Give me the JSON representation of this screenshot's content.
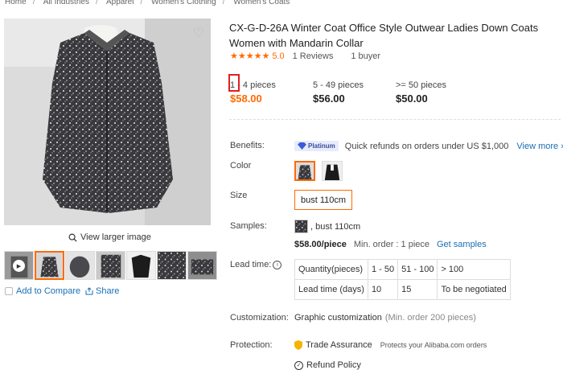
{
  "breadcrumb": [
    "Home",
    "All Industries",
    "Apparel",
    "Women's Clothing",
    "Women's Coats"
  ],
  "gallery": {
    "view_larger": "View larger image",
    "thumb_count": 7,
    "add_to_compare": "Add to Compare",
    "share": "Share"
  },
  "product": {
    "title": "CX-G-D-26A Winter Coat Office Style Outwear Ladies Down Coats Women with Mandarin Collar",
    "rating_stars": "★★★★★",
    "rating_score": "5.0",
    "reviews": "1 Reviews",
    "buyers": "1 buyer"
  },
  "price_tiers": [
    {
      "qty_num": "1",
      "qty_rest": " - 4 pieces",
      "price": "$58.00"
    },
    {
      "qty": "5 - 49 pieces",
      "price": "$56.00"
    },
    {
      "qty": ">= 50 pieces",
      "price": "$50.00"
    }
  ],
  "labels": {
    "benefits": "Benefits:",
    "color": "Color",
    "size": "Size",
    "samples": "Samples:",
    "lead_time": "Lead time:",
    "customization": "Customization:",
    "protection": "Protection:"
  },
  "benefits": {
    "badge": "Platinum",
    "text": "Quick refunds on orders under US $1,000",
    "view_more": "View more"
  },
  "size": {
    "selected": "bust 110cm"
  },
  "samples": {
    "variant": ", bust 110cm",
    "price": "$58.00/piece",
    "min_order": "Min. order : 1 piece",
    "get_samples": "Get samples"
  },
  "lead_time_table": {
    "rows": [
      [
        "Quantity(pieces)",
        "1 - 50",
        "51 - 100",
        "> 100"
      ],
      [
        "Lead time (days)",
        "10",
        "15",
        "To be negotiated"
      ]
    ]
  },
  "customization": {
    "value": "Graphic customization",
    "note": "(Min. order 200 pieces)"
  },
  "protection": {
    "trade_assurance": "Trade Assurance",
    "trade_sub": "Protects your Alibaba.com orders",
    "refund_policy": "Refund Policy"
  },
  "colors": {
    "accent": "#ff6a00",
    "link": "#1a6fb4",
    "highlight_box": "#e02020"
  }
}
